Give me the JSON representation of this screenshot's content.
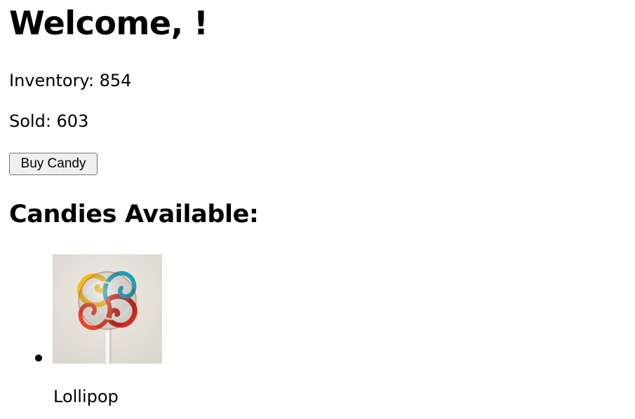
{
  "welcome": {
    "title": "Welcome, !"
  },
  "stats": {
    "inventory_label": "Inventory: 854",
    "sold_label": "Sold: 603"
  },
  "actions": {
    "buy_label": "Buy Candy"
  },
  "candies": {
    "heading": "Candies Available:",
    "items": [
      {
        "name": "Lollipop",
        "image_icon": "lollipop-image"
      }
    ]
  }
}
